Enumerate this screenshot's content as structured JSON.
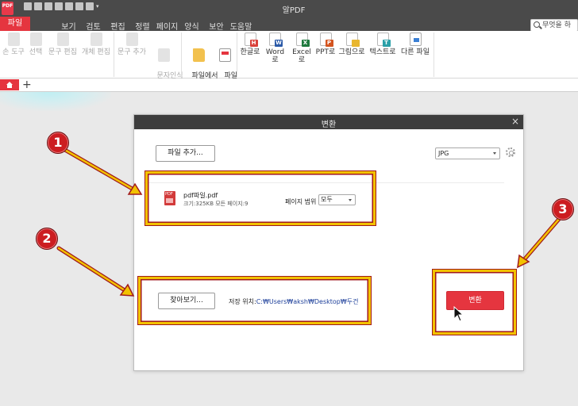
{
  "app": {
    "logo_text": "PDF",
    "title": "알PDF"
  },
  "menubar": {
    "file": "파일",
    "items": [
      "",
      "보기",
      "검토",
      "편집",
      "정렬",
      "페이지",
      "양식",
      "보안",
      "도움말"
    ]
  },
  "search": {
    "placeholder": "무엇을 하시"
  },
  "ribbon": {
    "tools": [
      {
        "label": "손 도구",
        "enabled": false
      },
      {
        "label": "선택",
        "enabled": false
      },
      {
        "label": "문구 편집",
        "enabled": false
      },
      {
        "label": "개체 편집",
        "enabled": false
      },
      {
        "label": "문구 추가",
        "enabled": false
      },
      {
        "label": "문자인식\n(OCR)",
        "enabled": false
      },
      {
        "label": "파일에서\n생성",
        "enabled": true
      },
      {
        "label": "파일\n병합",
        "enabled": true
      }
    ],
    "converters": [
      {
        "label": "한글로",
        "badge": "H",
        "color": "#d9413a"
      },
      {
        "label": "Word로",
        "badge": "W",
        "color": "#2b5aa8"
      },
      {
        "label": "Excel로",
        "badge": "X",
        "color": "#1f7a3e"
      },
      {
        "label": "PPT로",
        "badge": "P",
        "color": "#d3541f"
      },
      {
        "label": "그림으로",
        "badge": "",
        "color": "#e8b630"
      },
      {
        "label": "텍스트로",
        "badge": "T",
        "color": "#2aa0a8"
      },
      {
        "label": "다른 파일",
        "badge": "",
        "color": "#3a7fd4"
      }
    ]
  },
  "tabs": {
    "add": "+"
  },
  "dialog": {
    "title": "변환",
    "close": "×",
    "add_file": "파일 추가...",
    "format": "JPG",
    "file": {
      "name": "pdf파일.pdf",
      "meta": "크기:325KB    모든 페이지:9"
    },
    "page_range_label": "페이지 범위",
    "page_range_value": "모두",
    "browse": "찾아보기...",
    "save_label": "저장 위치:",
    "save_path": "C:₩Users₩aksh₩Desktop₩두건",
    "convert": "변환"
  },
  "annotations": {
    "labels": [
      "1",
      "2",
      "3"
    ],
    "highlight_color": "#f2c200",
    "badge_color": "#cc1d21"
  },
  "colors": {
    "accent": "#e5353f",
    "titlebar": "#4a4a4a"
  }
}
